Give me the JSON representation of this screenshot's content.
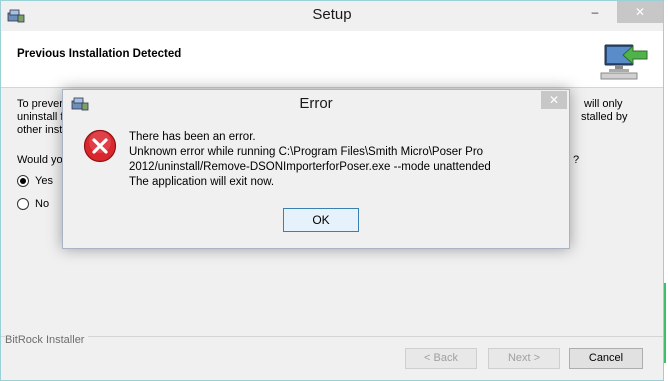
{
  "window": {
    "title": "Setup",
    "minimize_label": "–",
    "close_label": "✕"
  },
  "header": {
    "title": "Previous Installation Detected"
  },
  "content": {
    "paragraph_fragments": {
      "l1_left": "To prever",
      "l1_right": "will only",
      "l2_left": "uninstall f",
      "l2_right": "stalled by",
      "l3_left": "other inst"
    },
    "question_fragment": "Would yo",
    "question_end": "?",
    "options": [
      {
        "label": "Yes",
        "selected": true
      },
      {
        "label": "No",
        "selected": false
      }
    ]
  },
  "footer": {
    "installer_label": "BitRock Installer",
    "back_label": "< Back",
    "next_label": "Next >",
    "cancel_label": "Cancel"
  },
  "dialog": {
    "title": "Error",
    "close_label": "✕",
    "lines": [
      "There has been an error.",
      "Unknown error while running C:\\Program Files\\Smith Micro\\Poser Pro",
      "2012/uninstall/Remove-DSONImporterforPoser.exe --mode unattended",
      "The application will exit now."
    ],
    "ok_label": "OK"
  },
  "colors": {
    "error_red": "#d9272e",
    "ok_border": "#3c7fb1",
    "window_border": "#9bd0d6"
  }
}
